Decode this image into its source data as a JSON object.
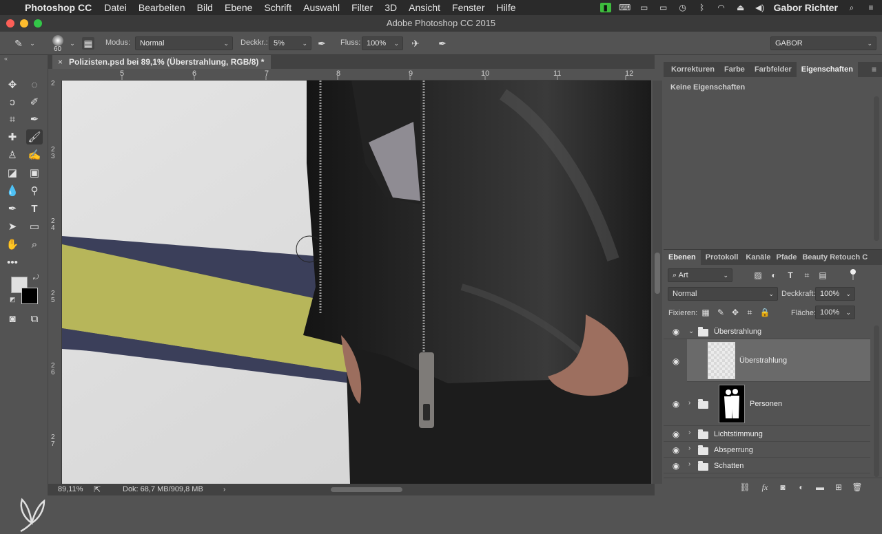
{
  "menubar": {
    "app_name": "Photoshop CC",
    "items": [
      "Datei",
      "Bearbeiten",
      "Bild",
      "Ebene",
      "Schrift",
      "Auswahl",
      "Filter",
      "3D",
      "Ansicht",
      "Fenster",
      "Hilfe"
    ],
    "username": "Gabor Richter"
  },
  "window": {
    "title": "Adobe Photoshop CC 2015"
  },
  "options": {
    "brush_size": "60",
    "mode_label": "Modus:",
    "mode_value": "Normal",
    "opacity_label": "Deckkr.:",
    "opacity_value": "5%",
    "flow_label": "Fluss:",
    "flow_value": "100%",
    "workspace": "GABOR"
  },
  "document": {
    "tab_title": "Polizisten.psd bei 89,1% (Überstrahlung, RGB/8) *",
    "ruler_top": [
      "5",
      "6",
      "7",
      "8",
      "9",
      "10",
      "11",
      "12"
    ],
    "ruler_left": [
      "2",
      "2\n3",
      "2\n4",
      "2\n5",
      "2\n6",
      "2\n7"
    ]
  },
  "status": {
    "zoom": "89,11%",
    "doc_size": "Dok: 68,7 MB/909,8 MB"
  },
  "properties_panel": {
    "tabs": [
      "Korrekturen",
      "Farbe",
      "Farbfelder",
      "Eigenschaften"
    ],
    "active_tab": "Eigenschaften",
    "content": "Keine Eigenschaften"
  },
  "layers_panel": {
    "tabs": [
      "Ebenen",
      "Protokoll",
      "Kanäle",
      "Pfade",
      "Beauty Retouch C"
    ],
    "active_tab": "Ebenen",
    "filter_type": "Art",
    "blend_mode": "Normal",
    "opacity_label": "Deckkraft:",
    "opacity_value": "100%",
    "lock_label": "Fixieren:",
    "fill_label": "Fläche:",
    "fill_value": "100%",
    "layers": [
      {
        "name": "Überstrahlung",
        "kind": "group",
        "expanded": true
      },
      {
        "name": "Überstrahlung",
        "kind": "layer",
        "selected": true
      },
      {
        "name": "Personen",
        "kind": "group-with-mask"
      },
      {
        "name": "Lichtstimmung",
        "kind": "group"
      },
      {
        "name": "Absperrung",
        "kind": "group"
      },
      {
        "name": "Schatten",
        "kind": "group"
      }
    ]
  },
  "colors": {
    "foreground": "#e0e0e0",
    "background": "#000000",
    "tape_yellow": "#b7b65a",
    "tape_navy": "#3b3f5a"
  }
}
